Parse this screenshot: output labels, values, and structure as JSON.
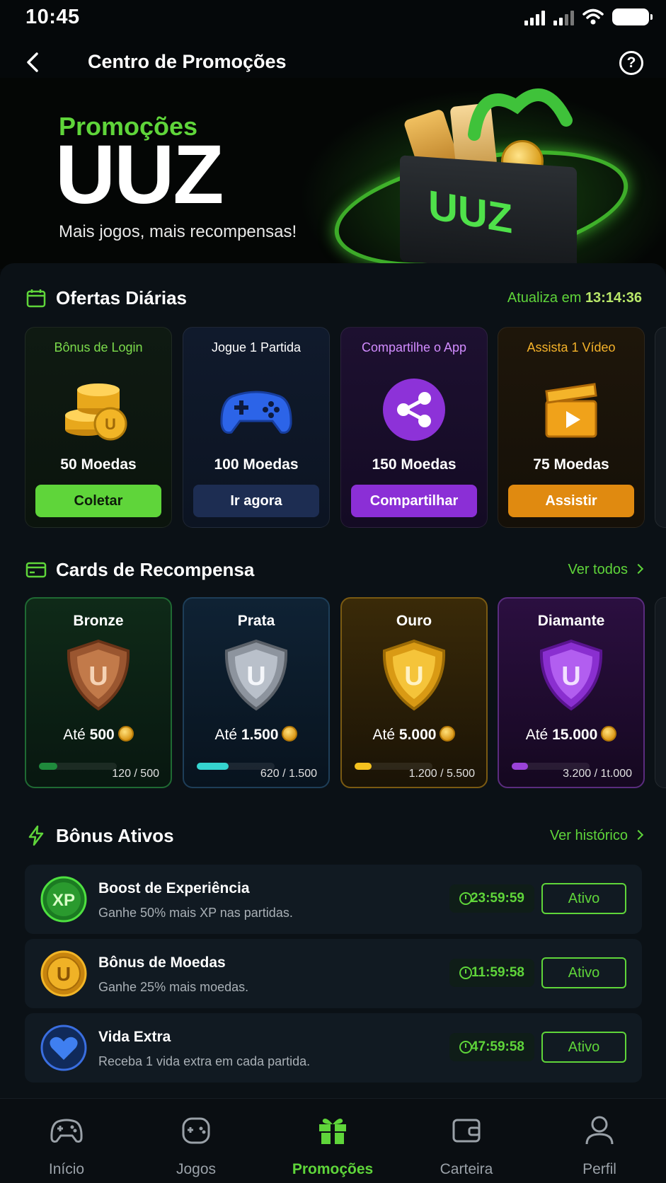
{
  "status_bar": {
    "time": "10:45"
  },
  "header": {
    "title": "Centro de Promoções",
    "help_label": "?"
  },
  "hero": {
    "kicker": "Promoções",
    "brand": "UUZ",
    "tagline": "Mais jogos, mais recompensas!",
    "box_label": "UUZ"
  },
  "daily_offers": {
    "title": "Ofertas Diárias",
    "refresh_prefix": "Atualiza em",
    "refresh_time": "13:14:36",
    "items": [
      {
        "title": "Bônus de Login",
        "amount": "50 Moedas",
        "button": "Coletar",
        "icon": "coins-stack-icon"
      },
      {
        "title": "Jogue 1 Partida",
        "amount": "100 Moedas",
        "button": "Ir agora",
        "icon": "gamepad-icon"
      },
      {
        "title": "Compartilhe o App",
        "amount": "150 Moedas",
        "button": "Compartilhar",
        "icon": "share-icon"
      },
      {
        "title": "Assista 1 Vídeo",
        "amount": "75 Moedas",
        "button": "Assistir",
        "icon": "video-clapper-icon"
      }
    ]
  },
  "reward_cards": {
    "title": "Cards de Recompensa",
    "view_all": "Ver todos",
    "items": [
      {
        "tier": "Bronze",
        "prefix": "Até",
        "limit": "500",
        "progress": "120 / 500",
        "fraction": 0.24,
        "color": "#b0653a"
      },
      {
        "tier": "Prata",
        "prefix": "Até",
        "limit": "1.500",
        "progress": "620 / 1.500",
        "fraction": 0.41,
        "color": "#b8bec8"
      },
      {
        "tier": "Ouro",
        "prefix": "Até",
        "limit": "5.000",
        "progress": "1.200 / 5.500",
        "fraction": 0.22,
        "color": "#f0b21c"
      },
      {
        "tier": "Diamante",
        "prefix": "Até",
        "limit": "15.000",
        "progress": "3.200 / 1t.000",
        "fraction": 0.21,
        "color": "#9b3fe0"
      }
    ]
  },
  "active_bonuses": {
    "title": "Bônus Ativos",
    "history": "Ver histórico",
    "items": [
      {
        "name": "Boost de Experiência",
        "desc": "Ganhe 50% mais XP nas partidas.",
        "timer": "23:59:59",
        "status": "Ativo",
        "icon_text": "XP",
        "icon": "xp-badge-icon"
      },
      {
        "name": "Bônus de Moedas",
        "desc": "Ganhe 25% mais moedas.",
        "timer": "11:59:58",
        "status": "Ativo",
        "icon_text": "U",
        "icon": "coin-badge-icon"
      },
      {
        "name": "Vida Extra",
        "desc": "Receba 1 vida extra em cada partida.",
        "timer": "47:59:58",
        "status": "Ativo",
        "icon_text": "",
        "icon": "heart-badge-icon"
      }
    ]
  },
  "bottom_nav": {
    "items": [
      {
        "label": "Início",
        "icon": "gamepad-home-icon"
      },
      {
        "label": "Jogos",
        "icon": "controller-icon"
      },
      {
        "label": "Promoções",
        "icon": "gift-icon",
        "active": true
      },
      {
        "label": "Carteira",
        "icon": "wallet-icon"
      },
      {
        "label": "Perfil",
        "icon": "user-icon"
      }
    ]
  },
  "colors": {
    "accent": "#5fd53a",
    "background": "#05080a",
    "panel": "#0b1116"
  }
}
